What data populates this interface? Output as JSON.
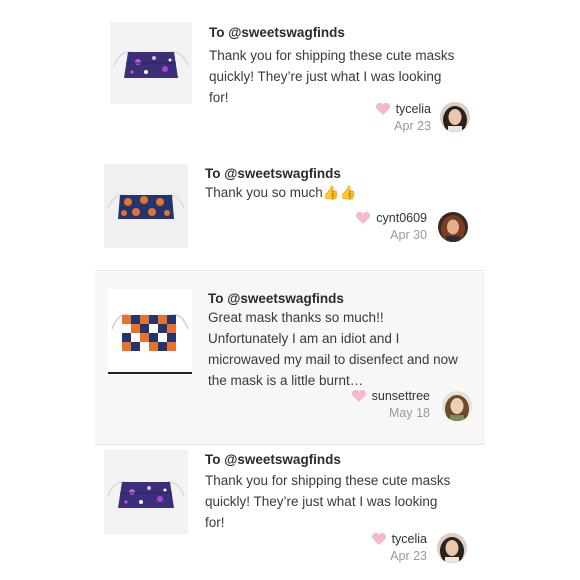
{
  "reviews": [
    {
      "to": "To @sweetswagfinds",
      "message": "Thank you for shipping these cute masks quickly! They’re just what I was looking for!",
      "username": "tycelia",
      "date": "Apr 23",
      "thumbnail": "purple-galaxy-mask",
      "like_icon": "heart-icon",
      "avatar": "avatar-dark-hair"
    },
    {
      "to": "To @sweetswagfinds",
      "message": "Thank you so much",
      "emoji": "👍👍",
      "username": "cynt0609",
      "date": "Apr 30",
      "thumbnail": "orange-blue-basketball-mask",
      "like_icon": "heart-icon",
      "avatar": "avatar-auburn-hair"
    },
    {
      "to": "To @sweetswagfinds",
      "message": "Great mask thanks so much!! Unfortunately I am an idiot and I microwaved my mail to disenfect and now the mask is a little burnt…",
      "username": "sunsettree",
      "date": "May 18",
      "thumbnail": "orange-blue-checker-mask",
      "like_icon": "heart-icon",
      "avatar": "avatar-brown-hair"
    },
    {
      "to": "To @sweetswagfinds",
      "message": "Thank you for shipping these cute masks quickly! They’re just what I was looking for!",
      "username": "tycelia",
      "date": "Apr 23",
      "thumbnail": "purple-galaxy-mask",
      "like_icon": "heart-icon",
      "avatar": "avatar-dark-hair"
    }
  ],
  "colors": {
    "heart": "#f7b9c8",
    "date": "#9a9a9a",
    "mask_purple": "#3b2f7a",
    "mask_orange": "#e8712b",
    "mask_blue": "#23346e"
  }
}
